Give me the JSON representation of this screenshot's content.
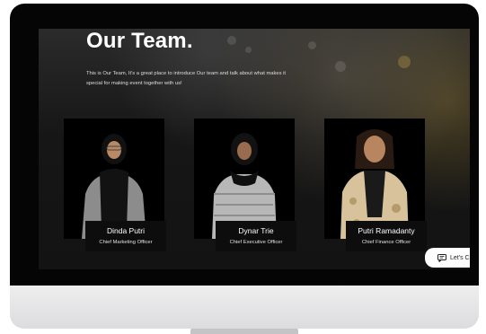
{
  "hero": {
    "title": "Our Team.",
    "intro": "This is Our Team, It's a great place to introduce Our team and talk about what makes it special for making event together with us!"
  },
  "team": [
    {
      "name": "Dinda Putri",
      "role": "Chief Marketing Officer"
    },
    {
      "name": "Dynar Trie",
      "role": "Chief Executive Officer"
    },
    {
      "name": "Putri Ramadanty",
      "role": "Chief Finance Officer"
    }
  ],
  "chat_widget": {
    "label": "Let's C",
    "icon": "chat-icon"
  },
  "colors": {
    "background": "#141414",
    "card": "#000000",
    "text": "#ffffff"
  }
}
